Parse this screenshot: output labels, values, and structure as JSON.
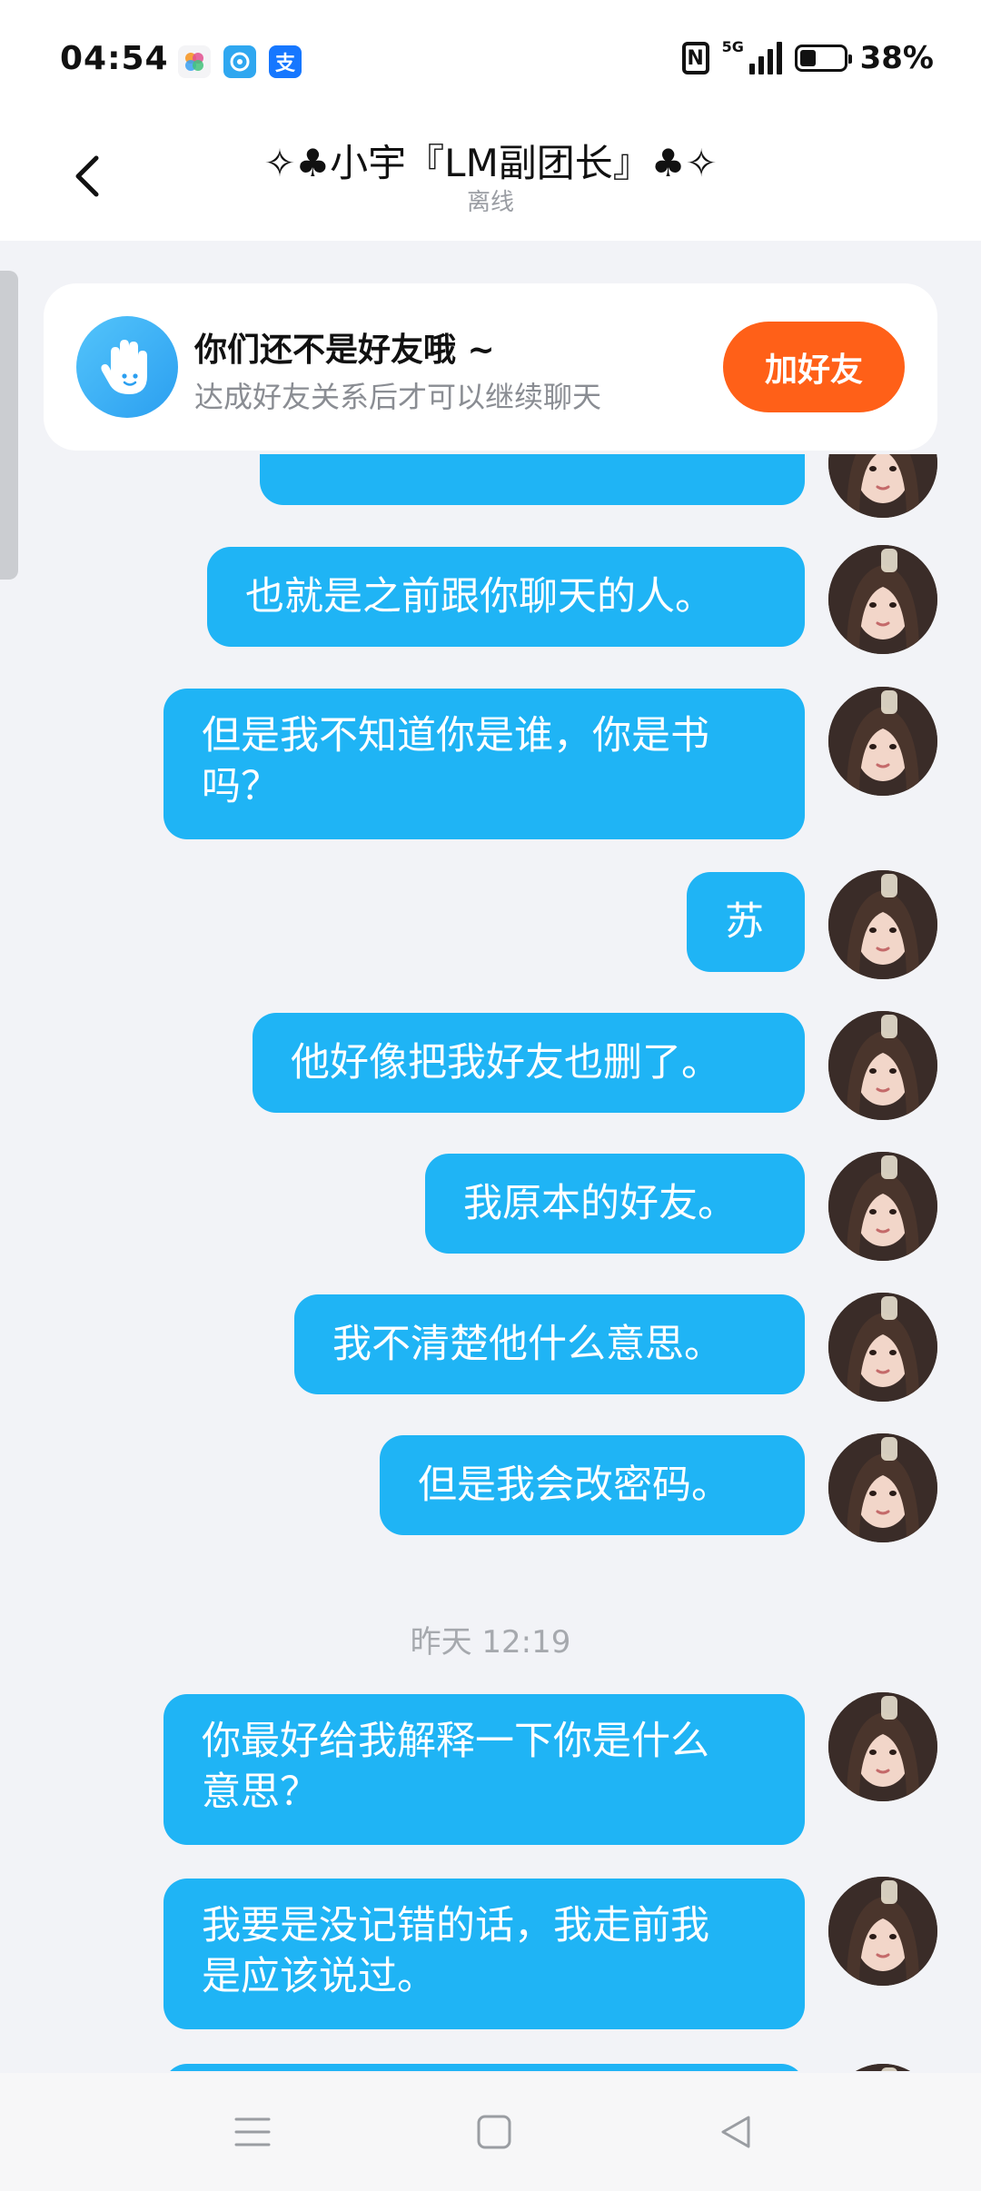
{
  "status_bar": {
    "time": "04:54",
    "network": "5G",
    "battery": "38%",
    "battery_level": 0.38,
    "app_icons": [
      "photos-icon",
      "browser-icon",
      "alipay-icon"
    ],
    "alipay_glyph": "支"
  },
  "header": {
    "title": "✧♣小宇『LM副团长』♣✧",
    "status": "离线"
  },
  "banner": {
    "title": "你们还不是好友哦 ~",
    "subtitle": "达成好友关系后才可以继续聊天",
    "button": "加好友"
  },
  "messages": [
    {
      "text": "也就是之前跟你聊天的人。"
    },
    {
      "text": "但是我不知道你是谁，你是书\n吗？"
    },
    {
      "text": "苏"
    },
    {
      "text": "他好像把我好友也删了。"
    },
    {
      "text": "我原本的好友。"
    },
    {
      "text": "我不清楚他什么意思。"
    },
    {
      "text": "但是我会改密码。"
    },
    {
      "timestamp": "昨天 12:19"
    },
    {
      "text": "你最好给我解释一下你是什么\n意思？"
    },
    {
      "text": "我要是没记错的话，我走前我\n是应该说过。"
    }
  ],
  "colors": {
    "bubble": "#1fb4f5",
    "add_button": "#ff6018",
    "background": "#f2f3f7"
  }
}
